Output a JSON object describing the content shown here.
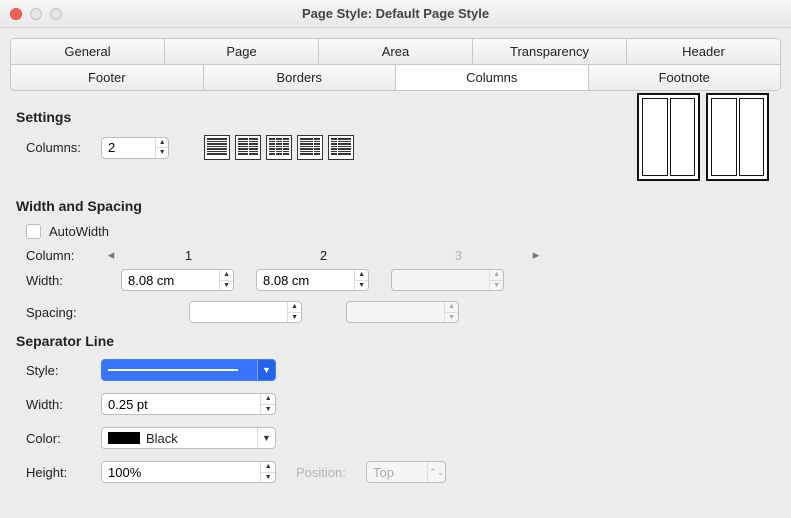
{
  "window": {
    "title": "Page Style: Default Page Style"
  },
  "tabs_row1": [
    {
      "label": "General"
    },
    {
      "label": "Page"
    },
    {
      "label": "Area"
    },
    {
      "label": "Transparency"
    },
    {
      "label": "Header"
    }
  ],
  "tabs_row2": [
    {
      "label": "Footer"
    },
    {
      "label": "Borders"
    },
    {
      "label": "Columns",
      "active": true
    },
    {
      "label": "Footnote"
    }
  ],
  "settings": {
    "heading": "Settings",
    "columns_label": "Columns:",
    "columns_value": "2"
  },
  "width_spacing": {
    "heading": "Width and Spacing",
    "autowidth_label": "AutoWidth",
    "column_label": "Column:",
    "width_label": "Width:",
    "spacing_label": "Spacing:",
    "col_headers": [
      "1",
      "2",
      "3"
    ],
    "width_values": [
      "8.08 cm",
      "8.08 cm",
      ""
    ],
    "spacing_values": [
      "",
      ""
    ]
  },
  "separator": {
    "heading": "Separator Line",
    "style_label": "Style:",
    "width_label": "Width:",
    "width_value": "0.25 pt",
    "color_label": "Color:",
    "color_name": "Black",
    "color_hex": "#000000",
    "height_label": "Height:",
    "height_value": "100%",
    "position_label": "Position:",
    "position_value": "Top"
  }
}
